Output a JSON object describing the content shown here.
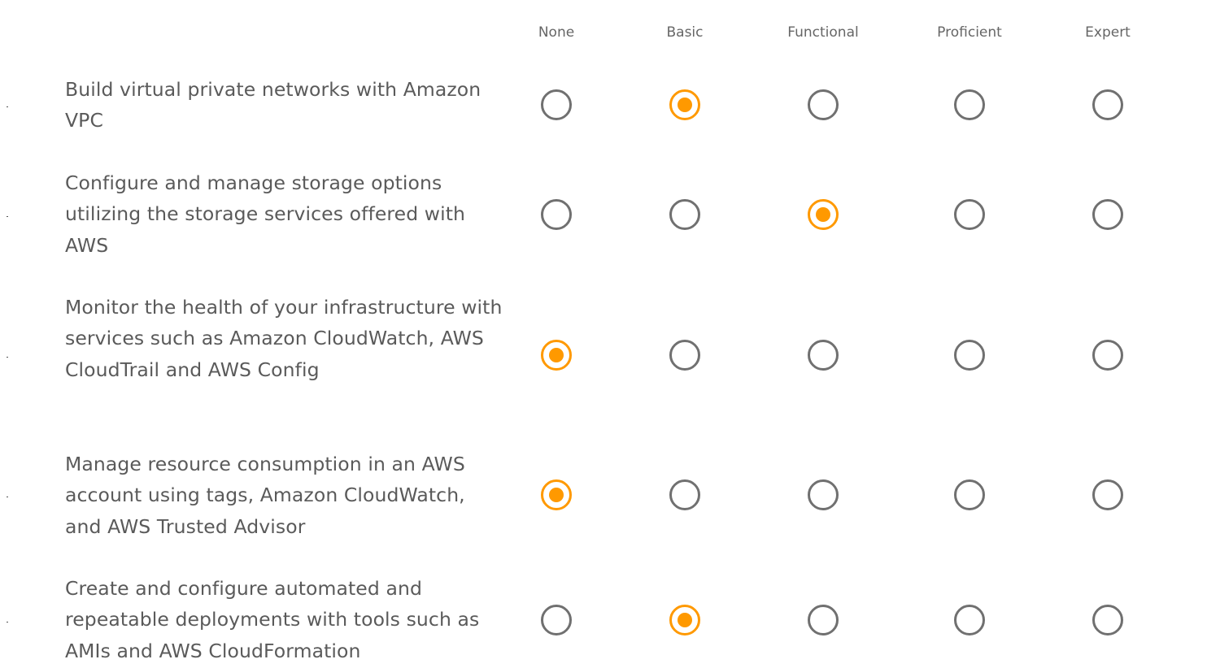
{
  "columns": [
    "None",
    "Basic",
    "Functional",
    "Proficient",
    "Expert"
  ],
  "rows": [
    {
      "label": "Build virtual private networks with Amazon VPC",
      "selected": "Basic"
    },
    {
      "label": "Configure and manage storage options utilizing the storage services offered with AWS",
      "selected": "Functional"
    },
    {
      "label": "Monitor the health of your infrastructure with services such as Amazon CloudWatch, AWS CloudTrail and AWS Config",
      "selected": "None"
    },
    {
      "label": "Manage resource consumption in an AWS account using tags, Amazon CloudWatch, and AWS Trusted Advisor",
      "selected": "None"
    },
    {
      "label": "Create and configure automated and repeatable deployments with tools such as AMIs and AWS CloudFormation",
      "selected": "Basic"
    }
  ],
  "colors": {
    "accent": "#ff9900",
    "radio_border": "#707070"
  }
}
